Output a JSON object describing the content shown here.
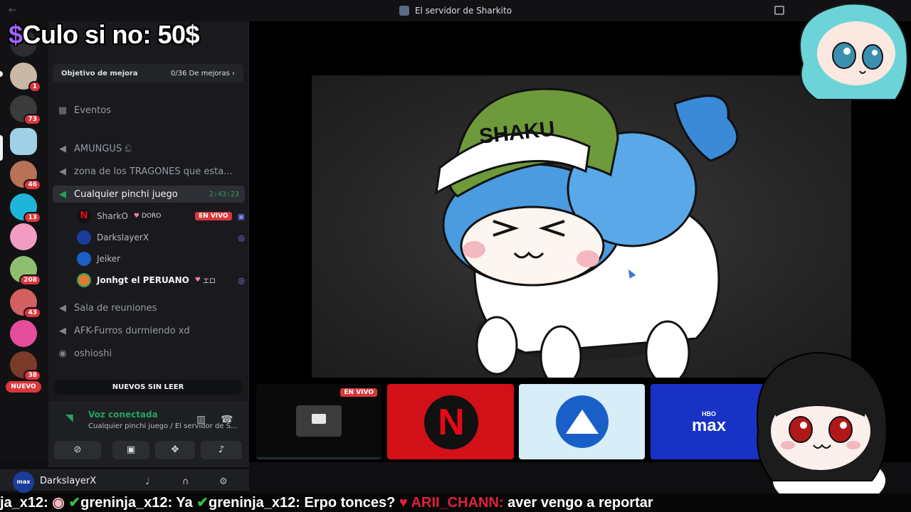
{
  "window": {
    "title": "El servidor de Sharkito"
  },
  "overlay": {
    "prefix": "$",
    "text": "Culo si no: 50$"
  },
  "guilds": {
    "badges": [
      "1",
      "73",
      "46",
      "13",
      "208",
      "43",
      "38"
    ],
    "nuevo": "NUEVO"
  },
  "channels": {
    "boost_label": "Objetivo de mejora",
    "boost_count": "0/36 De mejoras",
    "events": "Eventos",
    "items": [
      {
        "label": "AMUNGUS ඞ"
      },
      {
        "label": "zona de los TRAGONES que esta..."
      },
      {
        "label": "Cualquier pinchi juego",
        "timer": "2:43:23"
      },
      {
        "label": "Sala de reuniones"
      },
      {
        "label": "AFK-Furros durmiendo xd"
      },
      {
        "label": "oshioshi"
      }
    ],
    "voice_users": [
      {
        "name": "SharkO",
        "tag": "DORO",
        "live": "EN VIVO"
      },
      {
        "name": "DarkslayerX"
      },
      {
        "name": "Jeiker"
      },
      {
        "name": "Jonhgt el PERUANO",
        "tag": "エロ"
      }
    ],
    "unread": "NUEVOS SIN LEER"
  },
  "voice": {
    "status": "Voz conectada",
    "channel": "Cualquier pinchi juego / El servidor de S..."
  },
  "user": {
    "name": "DarkslayerX",
    "avatar": "max"
  },
  "stage": {
    "tiles": {
      "live": "EN VIVO",
      "netflix": "N",
      "hbo": "HBO",
      "max": "max"
    }
  },
  "chat": {
    "seg1": "ja_x12: ",
    "seg2": "greninja_x12: Ya ",
    "seg3": "greninja_x12: Erpo tonces? ",
    "seg4": "ARII_CHANN:",
    "seg5": " aver vengo a reportar"
  }
}
